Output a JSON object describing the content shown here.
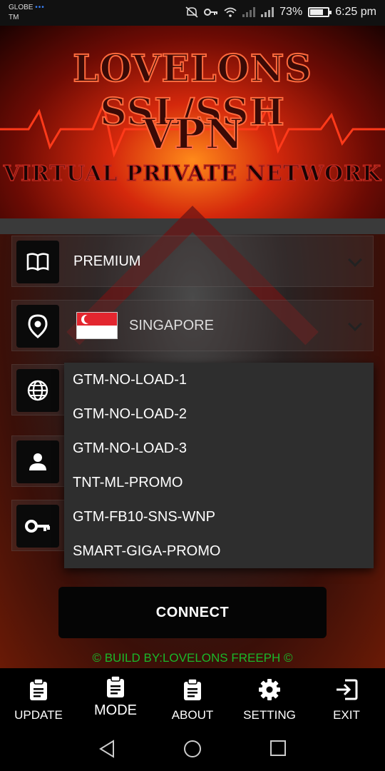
{
  "status_bar": {
    "carrier_line1": "GLOBE",
    "carrier_line2": "TM",
    "battery": "73%",
    "time": "6:25 pm"
  },
  "banner": {
    "title_line1": "LOVELONS SSL/SSH",
    "title_line2": "VPN",
    "title_line3": "VIRTUAL PRIVATE NETWORK"
  },
  "rows": {
    "plan": {
      "value": "PREMIUM",
      "icon": "book-icon"
    },
    "server": {
      "value": "SINGAPORE",
      "icon": "location-pin-icon",
      "flag": "singapore-flag"
    },
    "network": {
      "icon": "globe-icon"
    },
    "user": {
      "icon": "person-icon"
    },
    "password": {
      "icon": "key-icon"
    }
  },
  "dropdown": {
    "options": [
      "GTM-NO-LOAD-1",
      "GTM-NO-LOAD-2",
      "GTM-NO-LOAD-3",
      "TNT-ML-PROMO",
      "GTM-FB10-SNS-WNP",
      "SMART-GIGA-PROMO"
    ]
  },
  "connect_label": "CONNECT",
  "build_text": "© BUILD BY:LOVELONS FREEPH ©",
  "bottom_nav": [
    {
      "label": "UPDATE",
      "icon": "clipboard-icon"
    },
    {
      "label": "MODE",
      "icon": "clipboard-icon"
    },
    {
      "label": "ABOUT",
      "icon": "clipboard-icon"
    },
    {
      "label": "SETTING",
      "icon": "gear-icon"
    },
    {
      "label": "EXIT",
      "icon": "exit-icon"
    }
  ],
  "colors": {
    "build_text": "#1ab82a",
    "dropdown_bg": "#2e2e2e",
    "icon_box": "#0a0a0a",
    "flag_red": "#e3262f"
  }
}
